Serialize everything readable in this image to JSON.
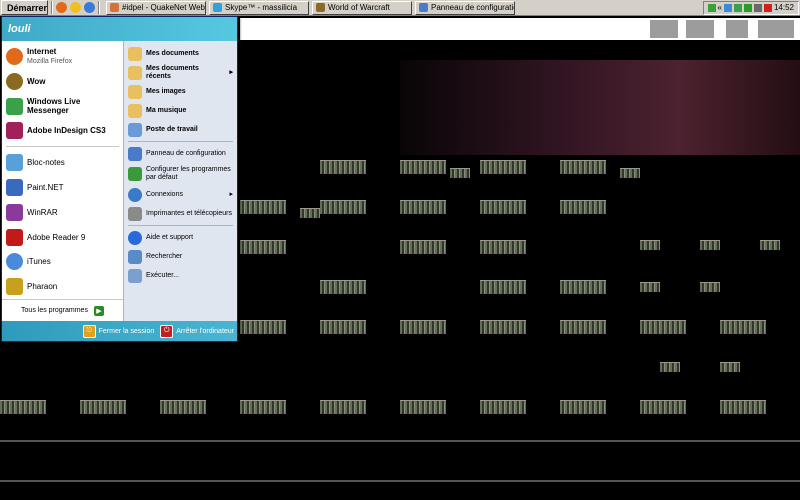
{
  "taskbar": {
    "start_label": "Démarrer",
    "tasks": [
      {
        "label": "#idpel - QuakeNet Web I...",
        "color": "#d0743a"
      },
      {
        "label": "Skype™ - massilicia",
        "color": "#2fa3e0"
      },
      {
        "label": "World of Warcraft",
        "color": "#8a6a2a"
      },
      {
        "label": "Panneau de configuration",
        "color": "#4a7ac8"
      }
    ],
    "clock": "14:52",
    "tray_chevron": "«"
  },
  "start_menu": {
    "user": "louli",
    "pinned": [
      {
        "title": "Internet",
        "subtitle": "Mozilla Firefox",
        "icon": "firefox-icon",
        "color": "#e06a1a"
      },
      {
        "title": "Wow",
        "subtitle": "",
        "icon": "wow-icon",
        "color": "#8a6a20"
      },
      {
        "title": "Windows Live Messenger",
        "subtitle": "",
        "icon": "messenger-icon",
        "color": "#3aa04a"
      },
      {
        "title": "Adobe InDesign CS3",
        "subtitle": "",
        "icon": "indesign-icon",
        "color": "#a0205a"
      }
    ],
    "recent": [
      {
        "title": "Bloc-notes",
        "icon": "notepad-icon",
        "color": "#5aa0d8"
      },
      {
        "title": "Paint.NET",
        "icon": "paintnet-icon",
        "color": "#3a6ac0"
      },
      {
        "title": "WinRAR",
        "icon": "winrar-icon",
        "color": "#8a3a9a"
      },
      {
        "title": "Adobe Reader 9",
        "icon": "adobe-reader-icon",
        "color": "#c01a1a"
      },
      {
        "title": "iTunes",
        "icon": "itunes-icon",
        "color": "#4a8ad8"
      },
      {
        "title": "Pharaon",
        "icon": "pharaon-icon",
        "color": "#c8a020"
      }
    ],
    "all_programs": "Tous les programmes",
    "places": [
      {
        "title": "Mes documents",
        "icon": "folder-documents-icon",
        "color": "#e8c060",
        "bold": true,
        "arrow": false
      },
      {
        "title": "Mes documents récents",
        "icon": "recent-documents-icon",
        "color": "#e8c060",
        "bold": true,
        "arrow": true
      },
      {
        "title": "Mes images",
        "icon": "folder-images-icon",
        "color": "#e8c060",
        "bold": true,
        "arrow": false
      },
      {
        "title": "Ma musique",
        "icon": "folder-music-icon",
        "color": "#e8c060",
        "bold": true,
        "arrow": false
      },
      {
        "title": "Poste de travail",
        "icon": "computer-icon",
        "color": "#6a9ad8",
        "bold": true,
        "arrow": false
      }
    ],
    "system": [
      {
        "title": "Panneau de configuration",
        "icon": "control-panel-icon",
        "color": "#4a7ac8",
        "arrow": false
      },
      {
        "title": "Configurer les programmes par défaut",
        "icon": "default-programs-icon",
        "color": "#3a9a3a",
        "arrow": false
      },
      {
        "title": "Connexions",
        "icon": "connections-icon",
        "color": "#3a7ac8",
        "arrow": true
      },
      {
        "title": "Imprimantes et télécopieurs",
        "icon": "printers-icon",
        "color": "#8a8a8a",
        "arrow": false
      }
    ],
    "help": [
      {
        "title": "Aide et support",
        "icon": "help-icon",
        "color": "#2a6ad8"
      },
      {
        "title": "Rechercher",
        "icon": "search-icon",
        "color": "#5a8ac8"
      },
      {
        "title": "Exécuter...",
        "icon": "run-icon",
        "color": "#7aa0d0"
      }
    ],
    "logoff": "Fermer la session",
    "shutdown": "Arrêter l'ordinateur"
  }
}
